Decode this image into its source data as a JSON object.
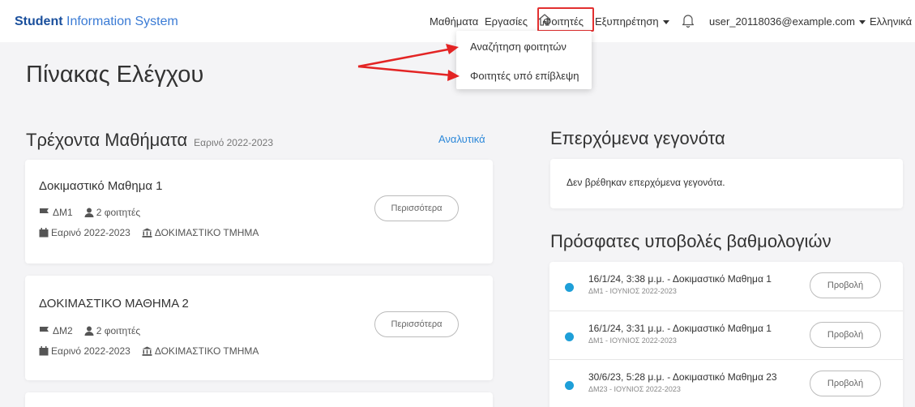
{
  "navbar": {
    "brand_bold": "Student",
    "brand_rest": " Information System",
    "links": {
      "courses": "Μαθήματα",
      "assignments": "Εργασίες",
      "students": "Φοιτητές",
      "services": "Εξυπηρέτηση",
      "user": "user_20118036@example.com",
      "language": "Ελληνικά"
    }
  },
  "dropdown": {
    "items": [
      "Αναζήτηση φοιτητών",
      "Φοιτητές υπό επίβλεψη"
    ]
  },
  "page": {
    "title": "Πίνακας Ελέγχου"
  },
  "current_courses": {
    "title": "Τρέχοντα Μαθήματα",
    "period": "Εαρινό 2022-2023",
    "analytics_link": "Αναλυτικά",
    "items": [
      {
        "title": "Δοκιμαστικό Μαθημα 1",
        "code": "ΔΜ1",
        "students": "2 φοιτητές",
        "period": "Εαρινό 2022-2023",
        "department": "ΔΟΚΙΜΑΣΤΙΚΟ ΤΜΗΜΑ",
        "more": "Περισσότερα"
      },
      {
        "title": "ΔΟΚΙΜΑΣΤΙΚΟ ΜΑΘΗΜΑ 2",
        "code": "ΔΜ2",
        "students": "2 φοιτητές",
        "period": "Εαρινό 2022-2023",
        "department": "ΔΟΚΙΜΑΣΤΙΚΟ ΤΜΗΜΑ",
        "more": "Περισσότερα"
      }
    ]
  },
  "upcoming_events": {
    "title": "Επερχόμενα γεγονότα",
    "empty_text": "Δεν βρέθηκαν επερχόμενα γεγονότα."
  },
  "recent_grades": {
    "title": "Πρόσφατες υποβολές βαθμολογιών",
    "items": [
      {
        "main": "16/1/24, 3:38 μ.μ. - Δοκιμαστικό Μαθημα 1",
        "sub": "ΔΜ1 - ΙΟΥΝΙΟΣ 2022-2023",
        "button": "Προβολή"
      },
      {
        "main": "16/1/24, 3:31 μ.μ. - Δοκιμαστικό Μαθημα 1",
        "sub": "ΔΜ1 - ΙΟΥΝΙΟΣ 2022-2023",
        "button": "Προβολή"
      },
      {
        "main": "30/6/23, 5:28 μ.μ. - Δοκιμαστικό Μαθημα 23",
        "sub": "ΔΜ23 - ΙΟΥΝΙΟΣ 2022-2023",
        "button": "Προβολή"
      }
    ]
  }
}
